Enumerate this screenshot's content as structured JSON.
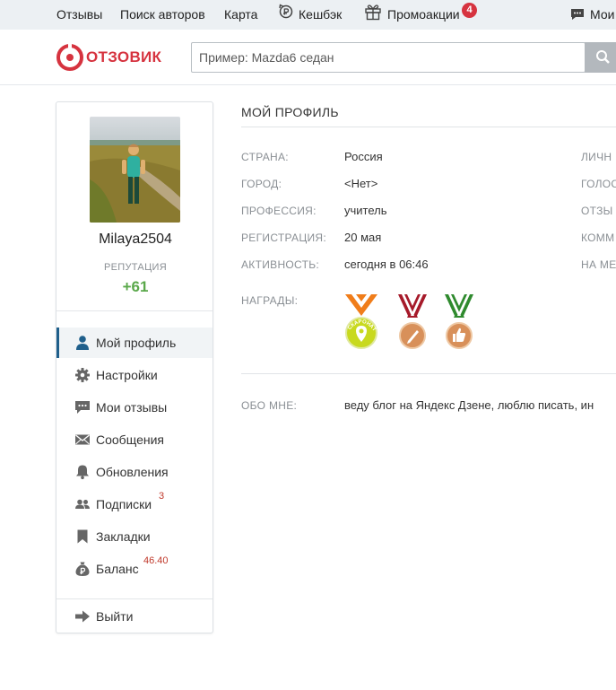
{
  "topnav": {
    "items": [
      "Отзывы",
      "Поиск авторов",
      "Карта",
      "Кешбэк",
      "Промоакции",
      "Мои"
    ],
    "promo_badge": "4"
  },
  "header": {
    "logo_text": "ОТЗОВИК",
    "search_placeholder": "Пример: Mazda6 седан"
  },
  "profile": {
    "username": "Milaya2504",
    "reputation_label": "РЕПУТАЦИЯ",
    "reputation_value": "+61"
  },
  "menu": {
    "items": [
      {
        "label": "Мой профиль",
        "icon": "user-icon"
      },
      {
        "label": "Настройки",
        "icon": "gear-icon"
      },
      {
        "label": "Мои отзывы",
        "icon": "chat-icon"
      },
      {
        "label": "Сообщения",
        "icon": "envelope-icon"
      },
      {
        "label": "Обновления",
        "icon": "bell-icon"
      },
      {
        "label": "Подписки",
        "icon": "users-icon",
        "badge": "3"
      },
      {
        "label": "Закладки",
        "icon": "bookmark-icon"
      },
      {
        "label": "Баланс",
        "icon": "money-bag-icon",
        "badge": "46.40"
      }
    ],
    "logout": "Выйти"
  },
  "main": {
    "title": "МОЙ ПРОФИЛЬ",
    "fields": [
      {
        "label": "СТРАНА:",
        "value": "Россия"
      },
      {
        "label": "ГОРОД:",
        "value": "<Нет>"
      },
      {
        "label": "ПРОФЕССИЯ:",
        "value": "учитель"
      },
      {
        "label": "РЕГИСТРАЦИЯ:",
        "value": "20 мая"
      },
      {
        "label": "АКТИВНОСТЬ:",
        "value": "сегодня в 06:46"
      }
    ],
    "right_labels": [
      "ЛИЧН",
      "ГОЛОС",
      "ОТЗЫ",
      "КОММ",
      "НА МЕ"
    ],
    "awards_label": "НАГРАДЫ:",
    "medal_text": "СКАРОНАТ",
    "about_label": "ОБО МНЕ:",
    "about_text": "веду блог на Яндекс Дзене, люблю писать, ин"
  },
  "colors": {
    "brand": "#d6333f",
    "reputation": "#5aa84a",
    "active_bar": "#1f5f8b",
    "badge": "#c0392b"
  }
}
